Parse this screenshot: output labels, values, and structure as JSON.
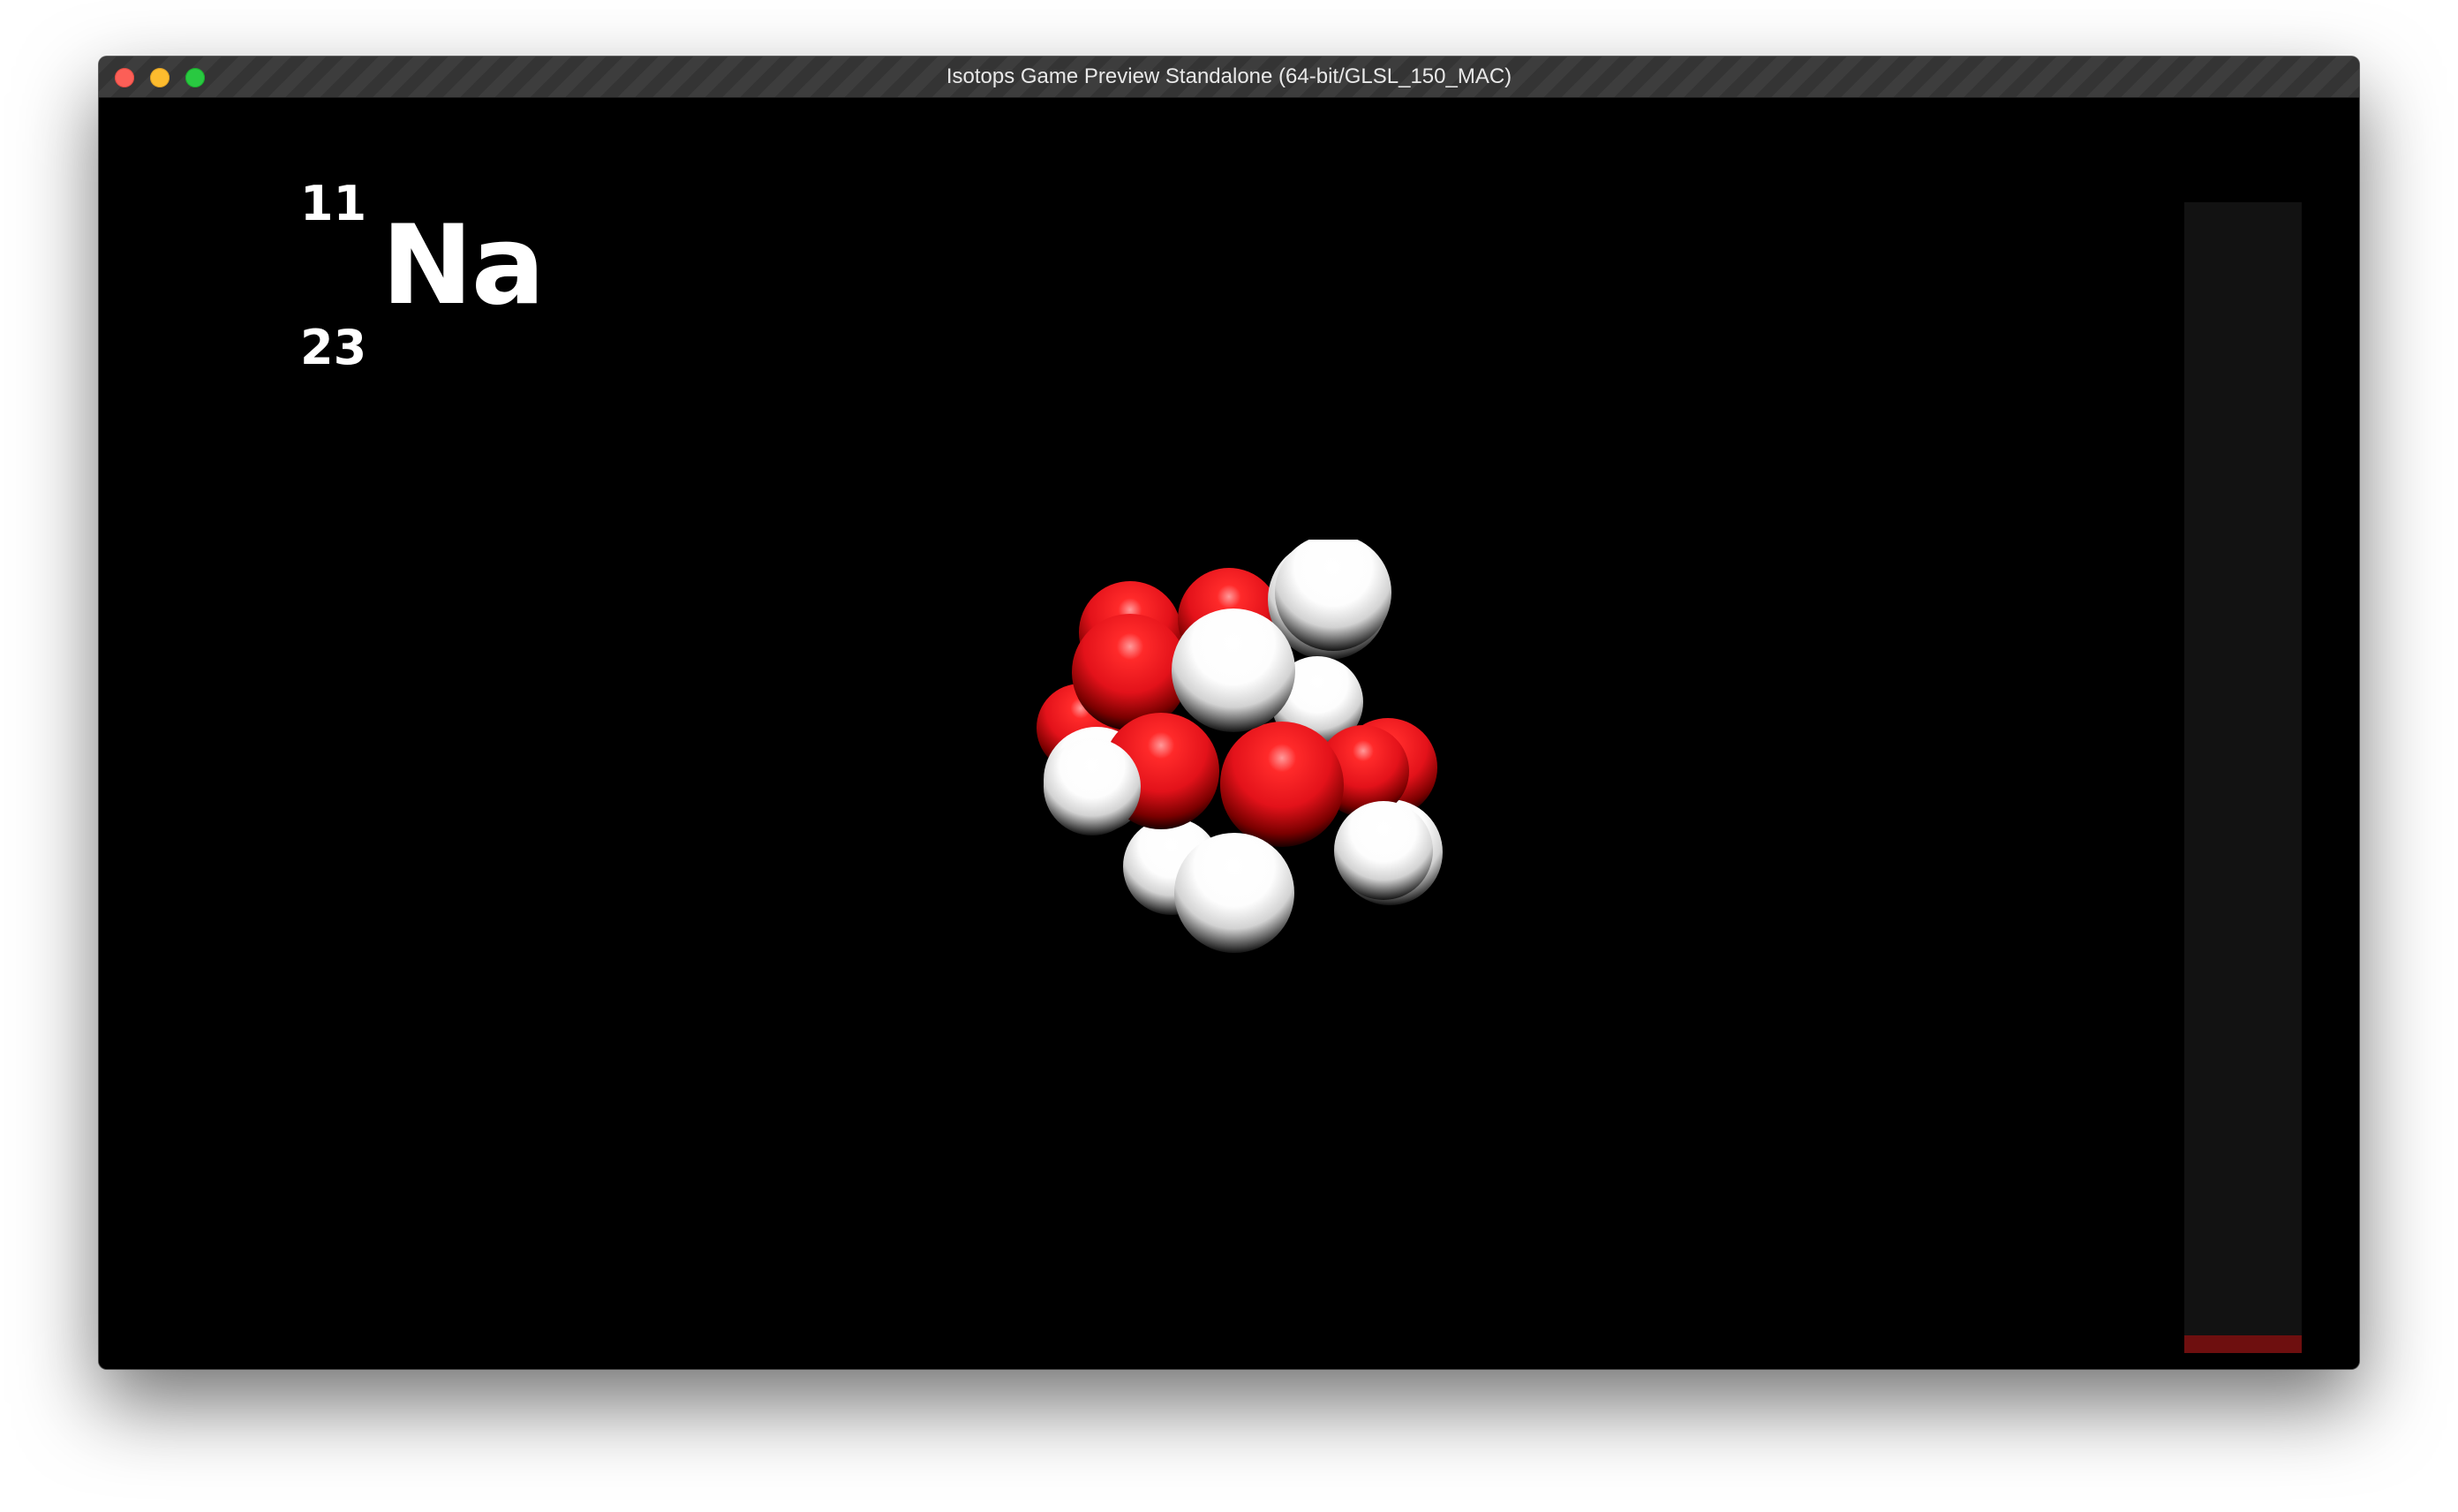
{
  "window": {
    "title": "Isotops Game Preview Standalone (64-bit/GLSL_150_MAC)"
  },
  "element": {
    "atomic_number": "11",
    "mass_number": "23",
    "symbol": "Na"
  },
  "nucleus": {
    "proton_color": "#e8141c",
    "neutron_color": "#ffffff"
  },
  "meter": {
    "fill_fraction": 0.015,
    "track_color": "#121212",
    "fill_color": "#6e0f0f"
  }
}
